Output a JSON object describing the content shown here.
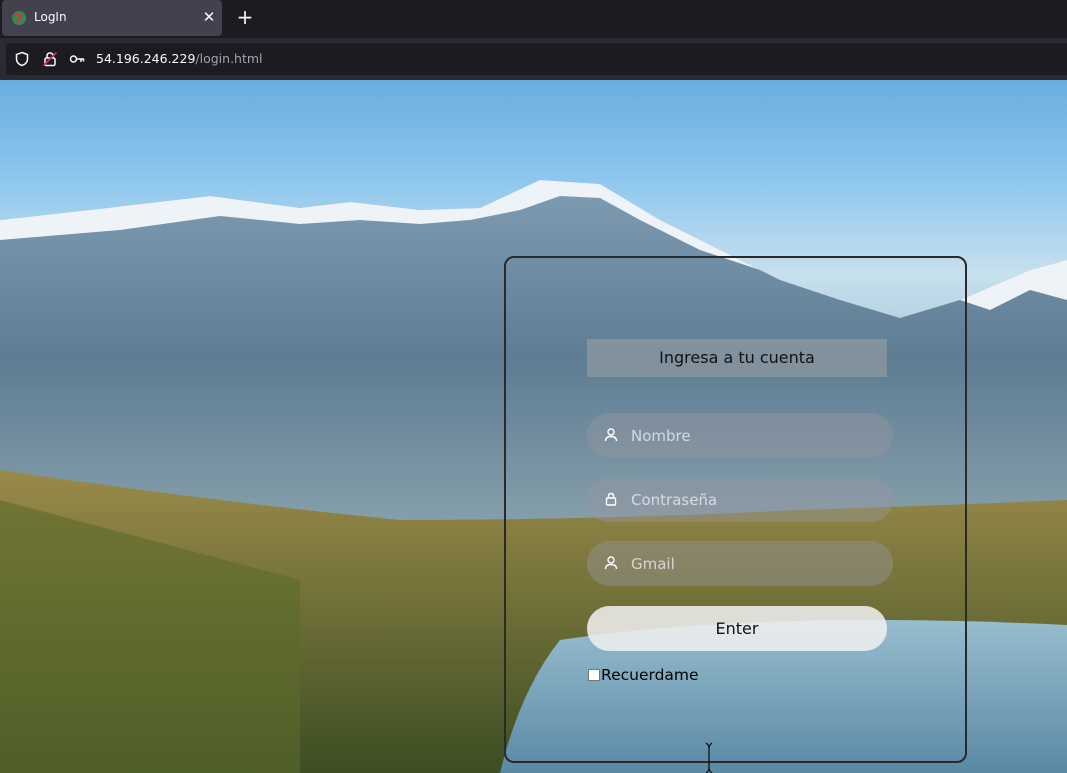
{
  "browser": {
    "tab_title": "LogIn",
    "close_glyph": "✕",
    "new_tab_glyph": "+",
    "url_host": "54.196.246.229",
    "url_path": "/login.html"
  },
  "icons": {
    "favicon": "globe-favicon-icon",
    "shield": "shield-icon",
    "lock": "lock-insecure-icon",
    "key": "key-icon",
    "user": "user-icon",
    "password_lock": "lock-icon"
  },
  "login": {
    "title": "Ingresa a tu cuenta",
    "name_placeholder": "Nombre",
    "password_placeholder": "Contraseña",
    "email_placeholder": "Gmail",
    "submit_label": "Enter",
    "remember_label": "Recuerdame",
    "remember_checked": false
  },
  "colors": {
    "browser_bg": "#1c1b22",
    "tab_active": "#42414d",
    "navbar": "#2b2a33",
    "login_border": "#2a2a2a"
  }
}
